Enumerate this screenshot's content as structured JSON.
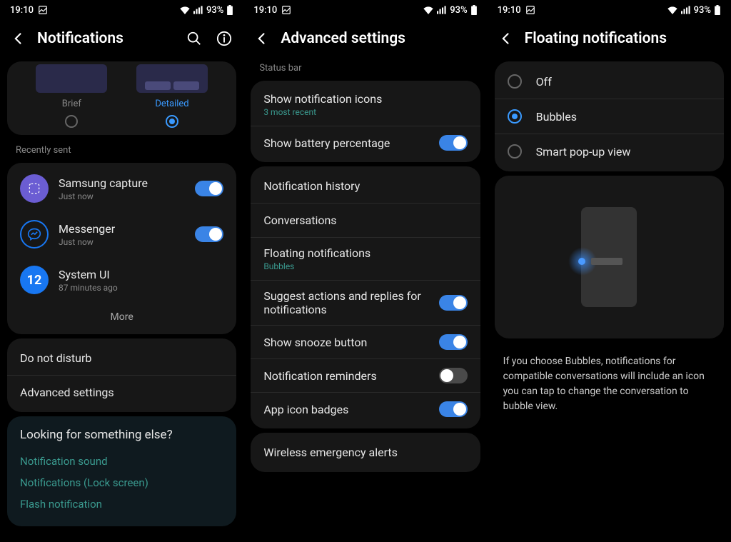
{
  "status": {
    "time": "19:10",
    "battery": "93%"
  },
  "screen1": {
    "title": "Notifications",
    "style_brief": "Brief",
    "style_detailed": "Detailed",
    "recently_sent": "Recently sent",
    "apps": [
      {
        "name": "Samsung capture",
        "time": "Just now"
      },
      {
        "name": "Messenger",
        "time": "Just now"
      },
      {
        "name": "System UI",
        "time": "87 minutes ago"
      }
    ],
    "more": "More",
    "dnd": "Do not disturb",
    "advanced": "Advanced settings",
    "looking_title": "Looking for something else?",
    "links": [
      "Notification sound",
      "Notifications (Lock screen)",
      "Flash notification"
    ]
  },
  "screen2": {
    "title": "Advanced settings",
    "section_statusbar": "Status bar",
    "show_icons": "Show notification icons",
    "show_icons_sub": "3 most recent",
    "show_battery": "Show battery percentage",
    "notif_history": "Notification history",
    "conversations": "Conversations",
    "floating": "Floating notifications",
    "floating_sub": "Bubbles",
    "suggest": "Suggest actions and replies for notifications",
    "snooze": "Show snooze button",
    "reminders": "Notification reminders",
    "badges": "App icon badges",
    "emergency": "Wireless emergency alerts"
  },
  "screen3": {
    "title": "Floating notifications",
    "off": "Off",
    "bubbles": "Bubbles",
    "popup": "Smart pop-up view",
    "description": "If you choose Bubbles, notifications for compatible conversations will include an icon you can tap to change the conversation to bubble view."
  }
}
